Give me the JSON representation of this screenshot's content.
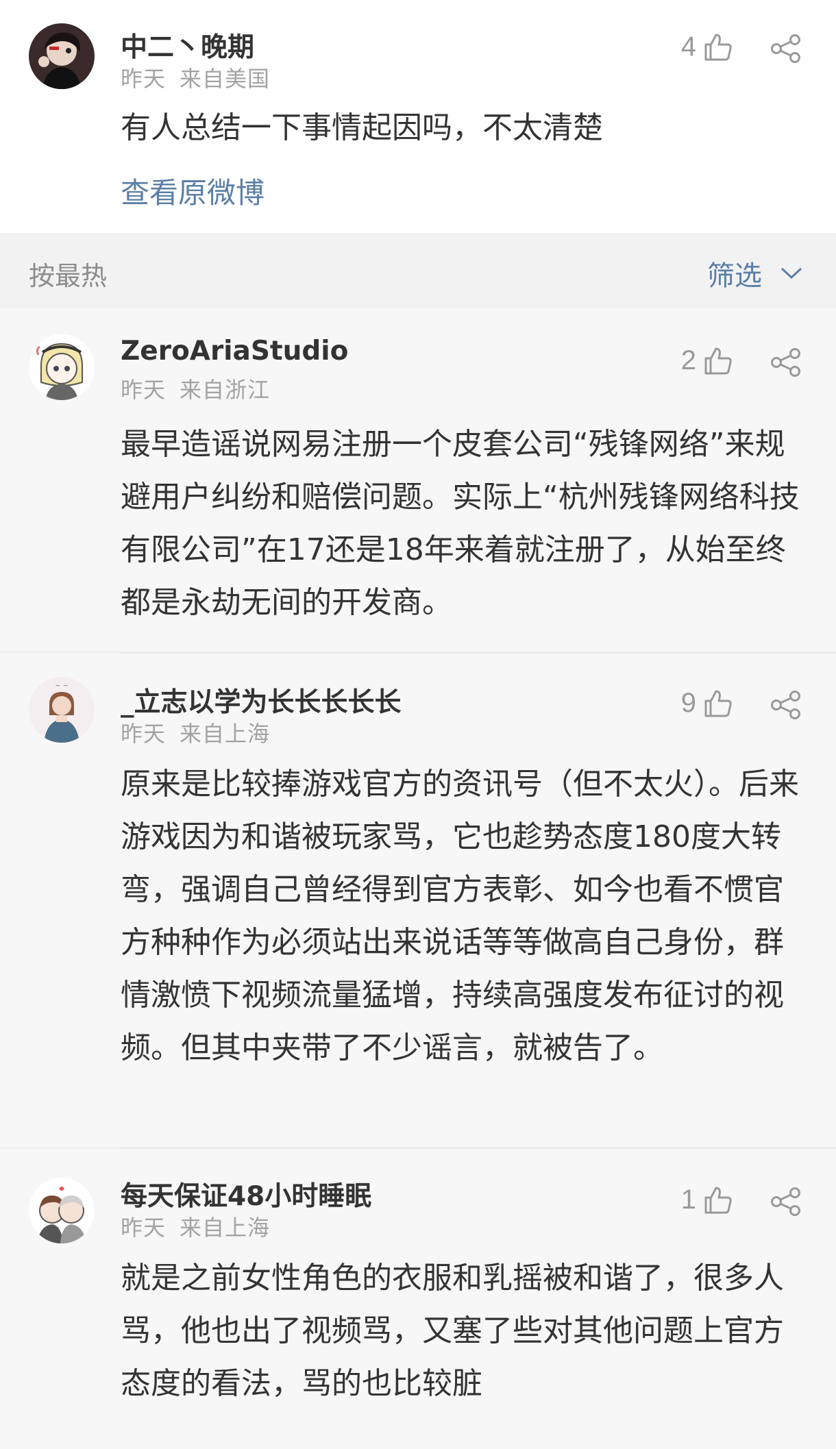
{
  "root_comment": {
    "username": "中二丶晚期",
    "time": "昨天",
    "location": "来自美国",
    "likes": "4",
    "text": "有人总结一下事情起因吗，不太清楚",
    "view_original": "查看原微博"
  },
  "sort_bar": {
    "sort_label": "按最热",
    "filter_label": "筛选"
  },
  "replies": [
    {
      "username": "ZeroAriaStudio",
      "time": "昨天",
      "location": "来自浙江",
      "likes": "2",
      "text": "最早造谣说网易注册一个皮套公司“残锋网络”来规避用户纠纷和赔偿问题。实际上“杭州残锋网络科技有限公司”在17还是18年来着就注册了，从始至终都是永劫无间的开发商。"
    },
    {
      "username": "_立志以学为长长长长长",
      "time": "昨天",
      "location": "来自上海",
      "likes": "9",
      "text": "原来是比较捧游戏官方的资讯号（但不太火）。后来游戏因为和谐被玩家骂，它也趁势态度180度大转弯，强调自己曾经得到官方表彰、如今也看不惯官方种种作为必须站出来说话等等做高自己身份，群情激愤下视频流量猛增，持续高强度发布征讨的视频。但其中夹带了不少谣言，就被告了。"
    },
    {
      "username": "每天保证48小时睡眠",
      "time": "昨天",
      "location": "来自上海",
      "likes": "1",
      "text": "就是之前女性角色的衣服和乳摇被和谐了，很多人骂，他也出了视频骂，又塞了些对其他问题上官方态度的看法，骂的也比较脏"
    }
  ],
  "icons": {
    "like": "thumbs-up-icon",
    "share": "share-icon",
    "filter_arrow": "chevron-down-icon"
  },
  "colors": {
    "link": "#5b7fa6",
    "meta": "#a3a3a3",
    "reply_bg": "#f7f7f7"
  }
}
